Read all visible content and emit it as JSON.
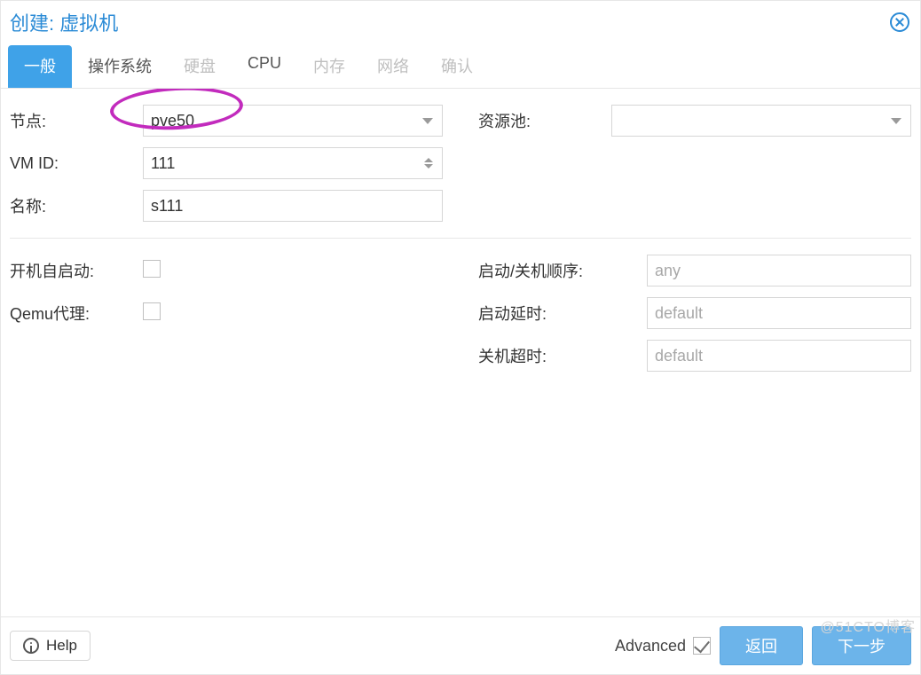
{
  "title": "创建: 虚拟机",
  "tabs": {
    "general": "一般",
    "os": "操作系统",
    "disk": "硬盘",
    "cpu": "CPU",
    "memory": "内存",
    "network": "网络",
    "confirm": "确认"
  },
  "form": {
    "node_label": "节点:",
    "node_value": "pve50",
    "vmid_label": "VM ID:",
    "vmid_value": "111",
    "name_label": "名称:",
    "name_value": "s111",
    "pool_label": "资源池:",
    "pool_value": "",
    "autostart_label": "开机自启动:",
    "qemu_agent_label": "Qemu代理:",
    "order_label": "启动/关机顺序:",
    "order_placeholder": "any",
    "startup_delay_label": "启动延时:",
    "startup_delay_placeholder": "default",
    "shutdown_timeout_label": "关机超时:",
    "shutdown_timeout_placeholder": "default"
  },
  "footer": {
    "help": "Help",
    "advanced": "Advanced",
    "back": "返回",
    "next": "下一步"
  },
  "watermark": "@51CTO博客"
}
